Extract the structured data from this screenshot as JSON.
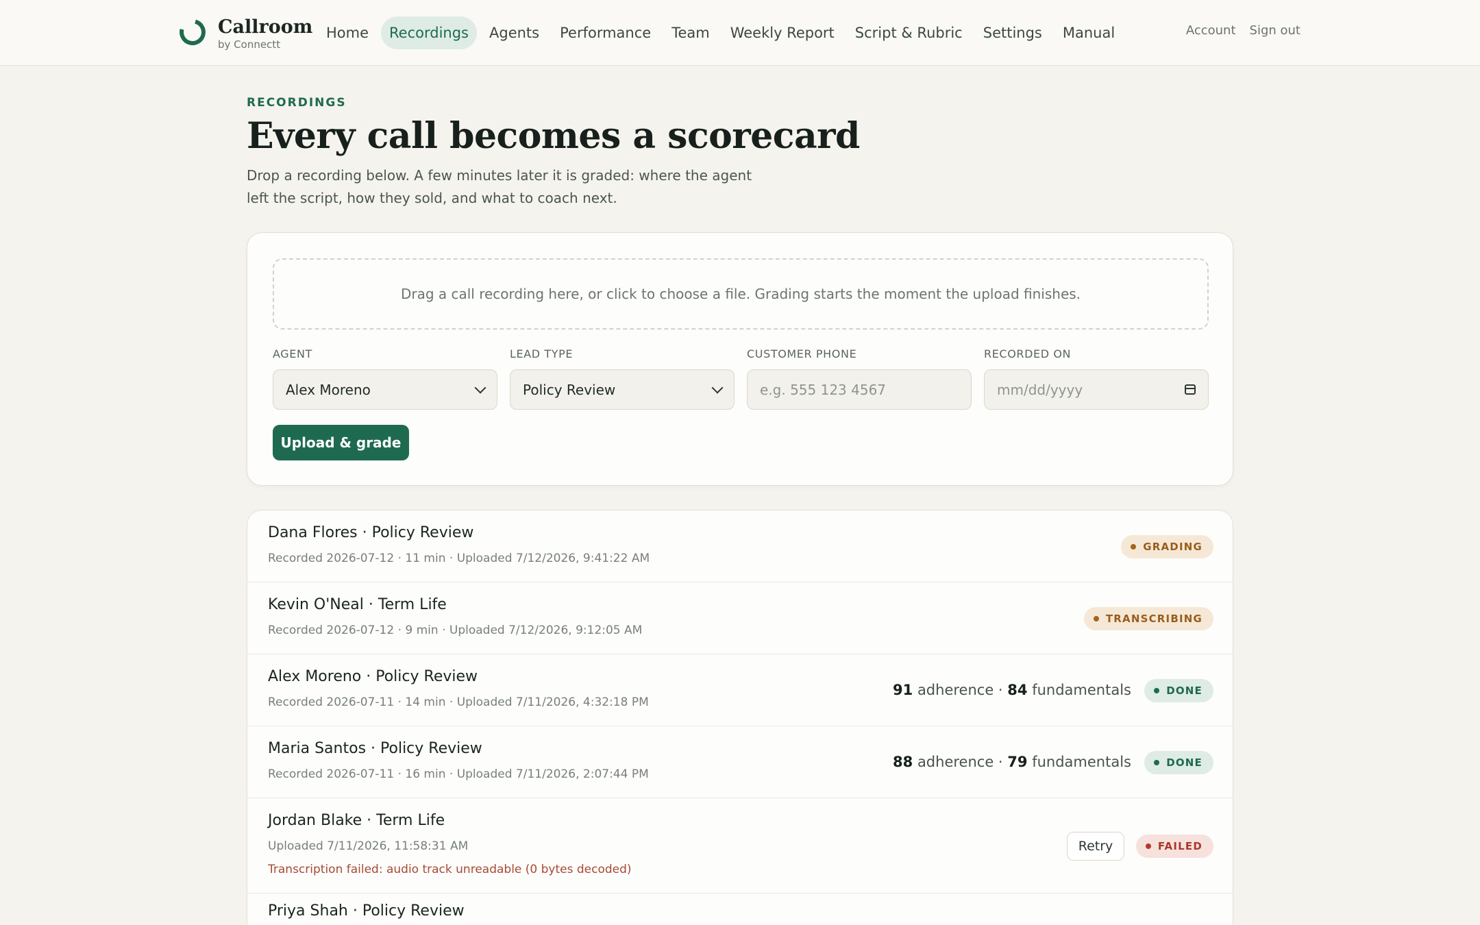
{
  "brand": {
    "name": "Callroom",
    "sub": "by Connectt"
  },
  "nav": {
    "links": [
      "Home",
      "Recordings",
      "Agents",
      "Performance",
      "Team",
      "Weekly Report",
      "Script & Rubric",
      "Settings",
      "Manual"
    ],
    "active": "Recordings",
    "account": "Account",
    "signout": "Sign out"
  },
  "header": {
    "eyebrow": "RECORDINGS",
    "title": "Every call becomes a scorecard",
    "description": "Drop a recording below. A few minutes later it is graded: where the agent left the script, how they sold, and what to coach next."
  },
  "upload": {
    "dropzone_text": "Drag a call recording here, or click to choose a file. Grading starts the moment the upload finishes.",
    "agent": {
      "label": "AGENT",
      "value": "Alex Moreno"
    },
    "lead_type": {
      "label": "LEAD TYPE",
      "value": "Policy Review"
    },
    "phone": {
      "label": "CUSTOMER PHONE",
      "placeholder": "e.g. 555 123 4567"
    },
    "recorded_on": {
      "label": "RECORDED ON",
      "placeholder": "mm/dd/yyyy"
    },
    "button": "Upload & grade"
  },
  "recordings": [
    {
      "title": "Dana Flores · Policy Review",
      "meta": "Recorded 2026-07-12 · 11 min · Uploaded 7/12/2026, 9:41:22 AM",
      "status": "GRADING"
    },
    {
      "title": "Kevin O'Neal · Term Life",
      "meta": "Recorded 2026-07-12 · 9 min · Uploaded 7/12/2026, 9:12:05 AM",
      "status": "TRANSCRIBING"
    },
    {
      "title": "Alex Moreno · Policy Review",
      "meta": "Recorded 2026-07-11 · 14 min · Uploaded 7/11/2026, 4:32:18 PM",
      "status": "DONE",
      "adherence": "91",
      "adherence_label": "adherence",
      "separator": "·",
      "fundamentals": "84",
      "fundamentals_label": "fundamentals"
    },
    {
      "title": "Maria Santos · Policy Review",
      "meta": "Recorded 2026-07-11 · 16 min · Uploaded 7/11/2026, 2:07:44 PM",
      "status": "DONE",
      "adherence": "88",
      "adherence_label": "adherence",
      "separator": "·",
      "fundamentals": "79",
      "fundamentals_label": "fundamentals"
    },
    {
      "title": "Jordan Blake · Term Life",
      "meta": "Uploaded 7/11/2026, 11:58:31 AM",
      "status": "FAILED",
      "error": "Transcription failed: audio track unreadable (0 bytes decoded)",
      "retry": "Retry"
    },
    {
      "title": "Priya Shah · Policy Review"
    }
  ],
  "colors": {
    "accent": "#1e6a50",
    "background": "#f5f3ee",
    "status_amber": "#9a5d1c",
    "status_green": "#1e6a50",
    "status_red": "#a8392a"
  }
}
